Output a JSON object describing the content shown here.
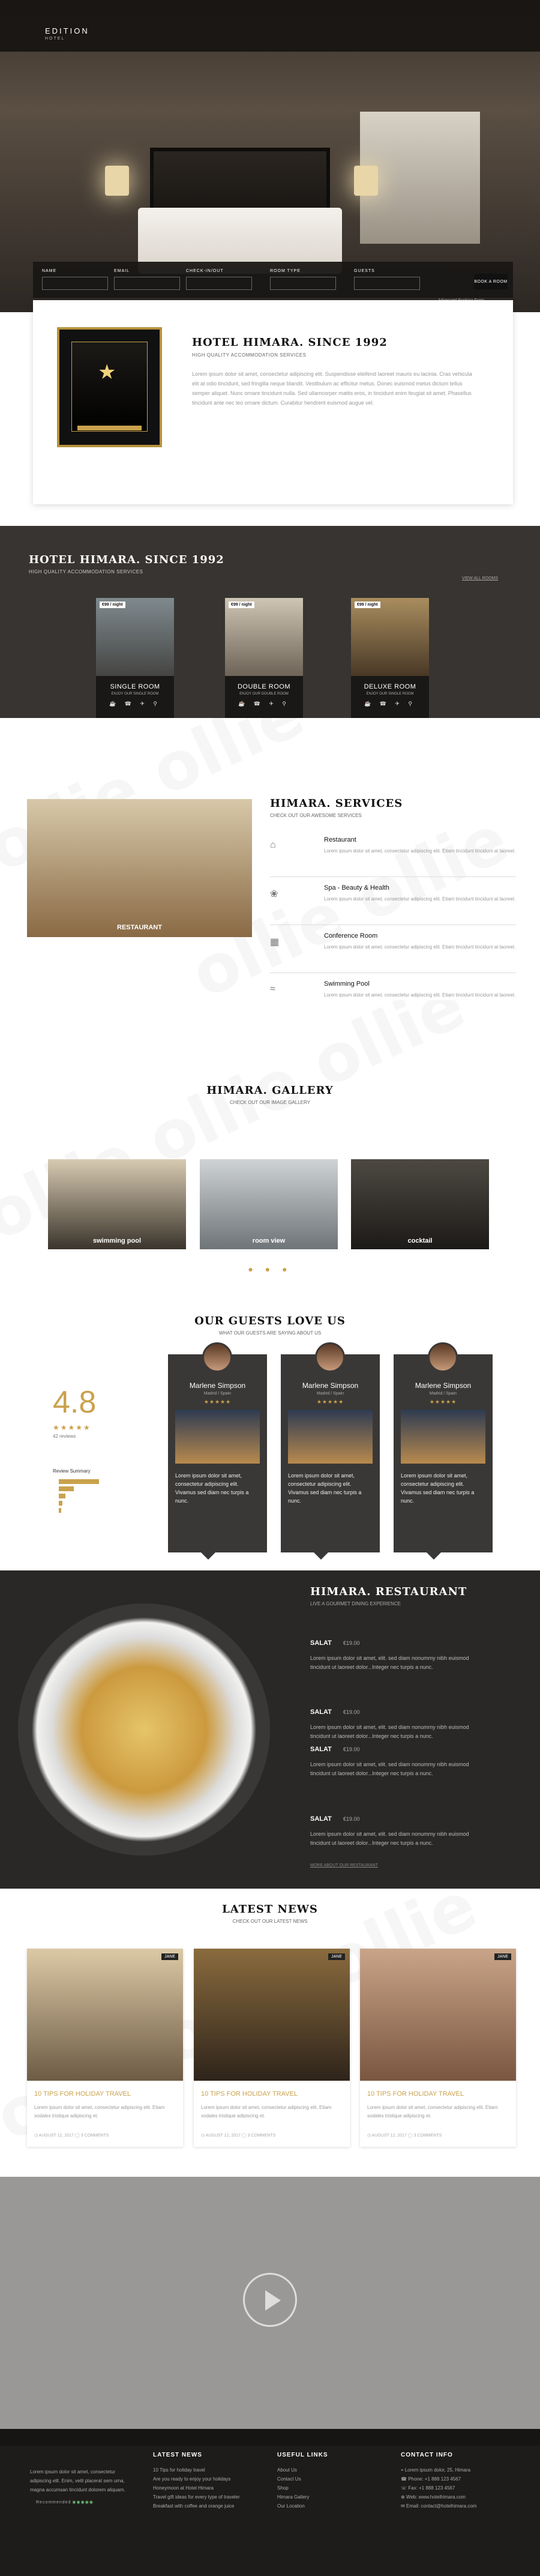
{
  "header": {
    "logo": "EDITION",
    "logo_sub": "HOTEL",
    "search": {
      "fields": [
        {
          "label": "NAME"
        },
        {
          "label": "EMAIL"
        },
        {
          "label": "CHECK-IN/OUT"
        },
        {
          "label": "ROOM TYPE"
        },
        {
          "label": "GUESTS"
        }
      ],
      "book_button": "BOOK A ROOM",
      "advanced": "Advanced Booking Form"
    }
  },
  "about": {
    "title": "HOTEL HIMARA. SINCE 1992",
    "subtitle": "HIGH QUALITY ACCOMMODATION SERVICES",
    "text": "Lorem ipsum dolor sit amet, consectetur adipiscing elit. Suspendisse eleifend laoreet mauris eu lacinia. Cras vehicula elit at odio tincidunt, sed fringilla neque blandit. Vestibulum ac efficitur metus. Donec euismod metus dictum tellus semper aliquet. Nunc ornare tincidunt nulla. Sed ullamcorper mattis eros, in tincidunt enim feugiat sit amet. Phasellus tincidunt ante nec leo ornare dictum. Curabitur hendrerit euismod augue vel."
  },
  "rooms": {
    "title": "HOTEL HIMARA. SINCE 1992",
    "subtitle": "HIGH QUALITY ACCOMMODATION SERVICES",
    "link": "VIEW ALL ROOMS",
    "items": [
      {
        "price": "€99 / night",
        "name": "SINGLE ROOM",
        "desc": "ENJOY OUR SINGLE ROOM",
        "icons": "☕ ☎ ✈ ⚲"
      },
      {
        "price": "€99 / night",
        "name": "DOUBLE ROOM",
        "desc": "ENJOY OUR DOUBLE ROOM",
        "icons": "☕ ☎ ✈ ⚲"
      },
      {
        "price": "€99 / night",
        "name": "DELUXE ROOM",
        "desc": "ENJOY OUR SINGLE ROOM",
        "icons": "☕ ☎ ✈ ⚲"
      }
    ]
  },
  "services": {
    "title": "HIMARA. SERVICES",
    "subtitle": "CHECK OUT OUR AWESOME SERVICES",
    "image_label": "RESTAURANT",
    "items": [
      {
        "icon": "restaurant-icon",
        "glyph": "⌂",
        "name": "Restaurant",
        "desc": "Lorem ipsum dolor sit amet, consectetur adipiscing elit. Etiam tincidunt tincidunt at laoreet."
      },
      {
        "icon": "spa-icon",
        "glyph": "❀",
        "name": "Spa - Beauty & Health",
        "desc": "Lorem ipsum dolor sit amet, consectetur adipiscing elit. Etiam tincidunt tincidunt at laoreet."
      },
      {
        "icon": "conference-icon",
        "glyph": "▦",
        "name": "Conference Room",
        "desc": "Lorem ipsum dolor sit amet, consectetur adipiscing elit. Etiam tincidunt tincidunt at laoreet."
      },
      {
        "icon": "pool-icon",
        "glyph": "≈",
        "name": "Swimming Pool",
        "desc": "Lorem ipsum dolor sit amet, consectetur adipiscing elit. Etiam tincidunt tincidunt at laoreet."
      }
    ]
  },
  "gallery": {
    "title": "HIMARA. GALLERY",
    "subtitle": "CHECK OUT OUR IMAGE GALLERY",
    "items": [
      {
        "label": "swimming pool"
      },
      {
        "label": "room view"
      },
      {
        "label": "cocktail"
      }
    ]
  },
  "guests": {
    "title": "OUR GUESTS LOVE US",
    "subtitle": "WHAT OUR GUESTS ARE SAYING ABOUT US",
    "rating": "4.8",
    "stars": "★★★★★",
    "reviews": "42 reviews",
    "review_summary": "Review Summary",
    "bars": [
      0.95,
      0.35,
      0.15,
      0.08,
      0.05
    ],
    "cards": [
      {
        "name": "Marlene Simpson",
        "role": "Madrid / Spain",
        "stars": "★★★★★",
        "text": "Lorem ipsum dolor sit amet, consectetur adipiscing elit. Vivamus sed diam nec turpis a nunc."
      },
      {
        "name": "Marlene Simpson",
        "role": "Madrid / Spain",
        "stars": "★★★★★",
        "text": "Lorem ipsum dolor sit amet, consectetur adipiscing elit. Vivamus sed diam nec turpis a nunc."
      },
      {
        "name": "Marlene Simpson",
        "role": "Madrid / Spain",
        "stars": "★★★★★",
        "text": "Lorem ipsum dolor sit amet, consectetur adipiscing elit. Vivamus sed diam nec turpis a nunc."
      }
    ]
  },
  "restaurant": {
    "title": "HIMARA. RESTAURANT",
    "subtitle": "LIVE A GOURMET DINING EXPERIENCE",
    "items": [
      {
        "name": "SALAT",
        "price": "€19.00",
        "desc": "Lorem ipsum dolor sit amet, elit. sed diam nonummy nibh euismod tincidunt ut laoreet dolor...Integer nec turpis a nunc."
      },
      {
        "name": "SALAT",
        "price": "€19.00",
        "desc": "Lorem ipsum dolor sit amet, elit. sed diam nonummy nibh euismod tincidunt ut laoreet dolor...Integer nec turpis a nunc."
      },
      {
        "name": "SALAT",
        "price": "€19.00",
        "desc": "Lorem ipsum dolor sit amet, elit. sed diam nonummy nibh euismod tincidunt ut laoreet dolor...Integer nec turpis a nunc."
      },
      {
        "name": "SALAT",
        "price": "€19.00",
        "desc": "Lorem ipsum dolor sit amet, elit. sed diam nonummy nibh euismod tincidunt ut laoreet dolor...Integer nec turpis a nunc."
      }
    ],
    "link": "MORE ABOUT OUR RESTAURANT"
  },
  "news": {
    "title": "LATEST NEWS",
    "subtitle": "CHECK OUT OUR LATEST NEWS",
    "items": [
      {
        "tag": "JANE",
        "title": "10 TIPS FOR HOLIDAY TRAVEL",
        "desc": "Lorem ipsum dolor sit amet, consectetur adipiscing elit. Etiam sodales tristique adipiscing et.",
        "meta": "◷ AUGUST 12, 2017   ◯ 3 COMMENTS"
      },
      {
        "tag": "JANE",
        "title": "10 TIPS FOR HOLIDAY TRAVEL",
        "desc": "Lorem ipsum dolor sit amet, consectetur adipiscing elit. Etiam sodales tristique adipiscing et.",
        "meta": "◷ AUGUST 12, 2017   ◯ 3 COMMENTS"
      },
      {
        "tag": "JANE",
        "title": "10 TIPS FOR HOLIDAY TRAVEL",
        "desc": "Lorem ipsum dolor sit amet, consectetur adipiscing elit. Etiam sodales tristique adipiscing et.",
        "meta": "◷ AUGUST 12, 2017   ◯ 3 COMMENTS"
      }
    ]
  },
  "footer": {
    "about": "Lorem ipsum dolor sit amet, consectetur adipiscing elit. Enim, velit placerat sem urna, magna accumsan tincidunt dolorem aliquam.",
    "recommended": "Recommended",
    "owl": "◉◉◉◉◉",
    "news_title": "LATEST NEWS",
    "news": [
      "10 Tips for holiday travel",
      "Are you ready to enjoy your holidays",
      "Honeymoon at Hotel Himara",
      "Travel gift ideas for every type of traveler",
      "Breakfast with coffee and orange juice"
    ],
    "links_title": "USEFUL LINKS",
    "links": [
      "About Us",
      "Contact Us",
      "Shop",
      "Himara Gallery",
      "Our Location"
    ],
    "contact_title": "CONTACT INFO",
    "contact": [
      "⌖ Lorem ipsum dolor, 25, Himara",
      "☎ Phone: +1 888 123 4567",
      "☏ Fax: +1 888 123 4567",
      "⊕ Web: www.hotelhimara.com",
      "✉ Email: contact@hotelhimara.com"
    ]
  }
}
